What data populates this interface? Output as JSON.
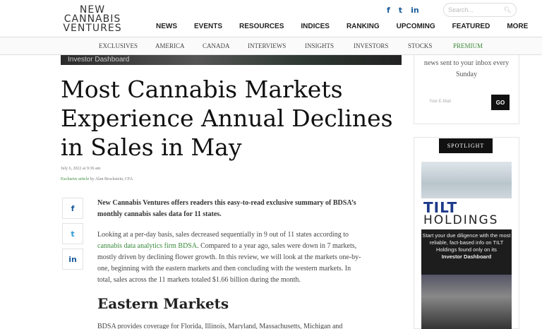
{
  "header": {
    "logo_lines": [
      "NEW",
      "CANNABIS",
      "VENTURES"
    ],
    "social": [
      {
        "icon": "facebook-icon",
        "glyph": "f"
      },
      {
        "icon": "twitter-icon",
        "glyph": "t"
      },
      {
        "icon": "linkedin-icon",
        "glyph": "in"
      }
    ],
    "search_placeholder": "Search...",
    "main_nav": [
      "NEWS",
      "EVENTS",
      "RESOURCES",
      "INDICES",
      "RANKING",
      "UPCOMING",
      "FEATURED",
      "MORE"
    ],
    "sub_nav": [
      "EXCLUSIVES",
      "AMERICA",
      "CANADA",
      "INTERVIEWS",
      "INSIGHTS",
      "INVESTORS",
      "STOCKS",
      "PREMIUM"
    ],
    "premium_color": "#3a8a3a"
  },
  "hero_caption": "Investor Dashboard",
  "article": {
    "title": "Most Cannabis Markets Experience Annual Declines in Sales in May",
    "date": "July 6, 2022 at 9:36 am",
    "category": "Exclusive article",
    "author": " by Alan Brochstein, CFA",
    "lead": "New Cannabis Ventures offers readers this easy-to-read exclusive summary of BDSA’s monthly cannabis sales data for 11 states.",
    "para1_a": "Looking at a per-day basis, sales decreased sequentially in 9 out of 11 states according to ",
    "para1_link": "cannabis data analytics firm BDSA",
    "para1_b": ". Compared to a year ago, sales were down in 7 markets, mostly driven by declining flower growth. In this review, we will look at the markets one-by-one, beginning with the eastern markets and then concluding with the western markets. In total, sales across the 11 markets totaled $1.66 billion during the month.",
    "h2": "Eastern Markets",
    "para2": "BDSA provides coverage for Florida, Illinois, Maryland, Massachusetts, Michigan and"
  },
  "share": [
    {
      "icon": "facebook-icon",
      "glyph": "f"
    },
    {
      "icon": "twitter-icon",
      "glyph": "t"
    },
    {
      "icon": "linkedin-icon",
      "glyph": "in"
    }
  ],
  "sidebar": {
    "newsletter_text": "news sent to your inbox every Sunday",
    "email_placeholder": "Your E-Mail",
    "go_label": "GO",
    "spotlight_label": "SPOTLIGHT",
    "ad": {
      "brand_line1": "TILT",
      "brand_line2": "HOLDINGS",
      "text": "Start your due diligence with the most reliable, fact-based info on TILT Holdings found only on its",
      "cta": "Investor Dashboard"
    }
  }
}
